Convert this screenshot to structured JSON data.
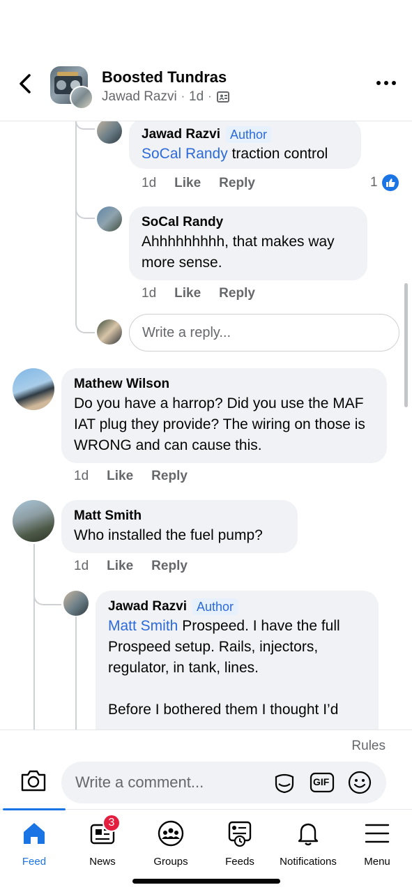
{
  "header": {
    "title": "Boosted Tundras",
    "author": "Jawad Razvi",
    "time": "1d",
    "separator": "·"
  },
  "comments": [
    {
      "name": "Jawad Razvi",
      "badge": "Author",
      "mention": "SoCal Randy",
      "text": " traction control",
      "time": "1d",
      "like_label": "Like",
      "reply_label": "Reply",
      "reaction_count": "1"
    },
    {
      "name": "SoCal Randy",
      "text": "Ahhhhhhhhh, that makes way more sense.",
      "time": "1d",
      "like_label": "Like",
      "reply_label": "Reply"
    },
    {
      "name": "Mathew Wilson",
      "text": "Do you have a harrop? Did you use the MAF IAT plug they provide? The wiring on those is WRONG and can cause this.",
      "time": "1d",
      "like_label": "Like",
      "reply_label": "Reply"
    },
    {
      "name": "Matt Smith",
      "text": "Who installed the fuel pump?",
      "time": "1d",
      "like_label": "Like",
      "reply_label": "Reply"
    },
    {
      "name": "Jawad Razvi",
      "badge": "Author",
      "mention": "Matt Smith",
      "text": " Prospeed. I have the full Prospeed setup. Rails, injectors, regulator, in tank, lines.",
      "text2": "Before I bothered them I thought I’d"
    }
  ],
  "reply_input": {
    "placeholder": "Write a reply..."
  },
  "composer": {
    "rules_label": "Rules",
    "placeholder": "Write a comment...",
    "gif_label": "GIF"
  },
  "tabs": [
    {
      "label": "Feed",
      "icon": "home-icon",
      "active": true
    },
    {
      "label": "News",
      "icon": "news-icon",
      "badge": "3"
    },
    {
      "label": "Groups",
      "icon": "groups-icon"
    },
    {
      "label": "Feeds",
      "icon": "feeds-icon"
    },
    {
      "label": "Notifications",
      "icon": "bell-icon"
    },
    {
      "label": "Menu",
      "icon": "menu-icon"
    }
  ],
  "colors": {
    "accent": "#1b74e4",
    "link": "#2d6ad9",
    "bubble": "#f0f2f5",
    "muted": "#65676b",
    "badge_red": "#e41e3f"
  }
}
